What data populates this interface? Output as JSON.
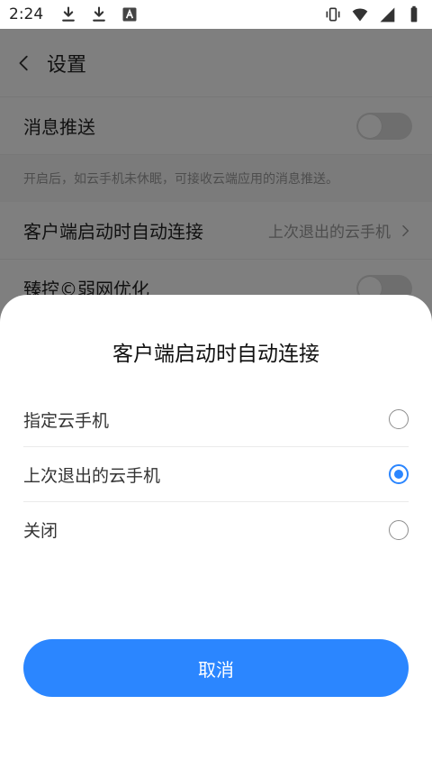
{
  "status_bar": {
    "time": "2:24",
    "icons_left": [
      "download-icon",
      "download-icon",
      "a-box-icon"
    ],
    "icons_right": [
      "vibrate-icon",
      "wifi-icon",
      "signal-icon",
      "battery-icon"
    ]
  },
  "settings": {
    "title": "设置",
    "rows": [
      {
        "label": "消息推送",
        "type": "toggle",
        "on": false
      },
      {
        "description": "开启后，如云手机未休眠，可接收云端应用的消息推送。"
      },
      {
        "label": "客户端启动时自动连接",
        "type": "value",
        "value": "上次退出的云手机"
      },
      {
        "label": "臻控©弱网优化",
        "type": "toggle",
        "on": false
      }
    ]
  },
  "sheet": {
    "title": "客户端启动时自动连接",
    "options": [
      {
        "label": "指定云手机",
        "selected": false
      },
      {
        "label": "上次退出的云手机",
        "selected": true
      },
      {
        "label": "关闭",
        "selected": false
      }
    ],
    "cancel_label": "取消"
  },
  "colors": {
    "accent": "#2b86ff",
    "overlay": "rgba(0,0,0,0.5)",
    "text_primary": "#222222",
    "text_secondary": "#9a9a9a"
  }
}
